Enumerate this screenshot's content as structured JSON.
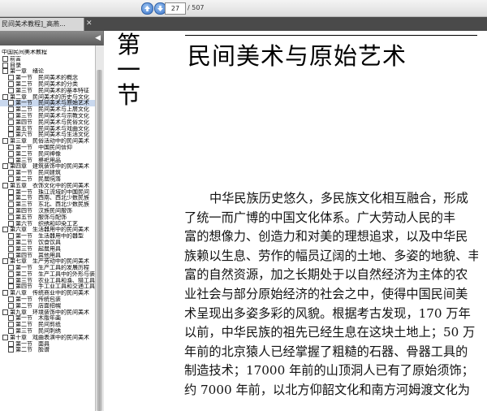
{
  "toolbar": {
    "prev_icon": "up-arrow-icon",
    "next_icon": "down-arrow-icon",
    "page_current": "27",
    "page_total": "/ 507"
  },
  "tab": {
    "title": "民间美术教程]_高燕...",
    "close_icon": "close-icon"
  },
  "sidebar": {
    "collapse_icon": "triangle-left-icon",
    "items": [
      {
        "label": "中国民间美术教程",
        "level": 0
      },
      {
        "label": "前言",
        "level": 1
      },
      {
        "label": "目录",
        "level": 1
      },
      {
        "label": "第一章　绪论",
        "level": 1
      },
      {
        "label": "第一节　民间美术的概念",
        "level": 2
      },
      {
        "label": "第二节　民间美术的分类",
        "level": 2
      },
      {
        "label": "第三节　民间美术的基本特征",
        "level": 2
      },
      {
        "label": "第二章　民间美术的历史与文化",
        "level": 1
      },
      {
        "label": "第一节　民间美术与原始艺术",
        "level": 2,
        "selected": true
      },
      {
        "label": "第二节　民间美术与上层文化",
        "level": 2
      },
      {
        "label": "第三节　民间美术与宗教文化",
        "level": 2
      },
      {
        "label": "第四节　民间美术与民俗文化",
        "level": 2
      },
      {
        "label": "第五节　民间美术与戏曲文化",
        "level": 2
      },
      {
        "label": "第六节　民间美术与生活文化",
        "level": 2
      },
      {
        "label": "第三章　民俗活动中的民间美术",
        "level": 1
      },
      {
        "label": "第一节　中国民间信仰",
        "level": 2
      },
      {
        "label": "第二节　民间神像",
        "level": 2
      },
      {
        "label": "第三节　祭祀用品",
        "level": 2
      },
      {
        "label": "第四章　建筑装饰中的民间美术",
        "level": 1
      },
      {
        "label": "第一节　民间建筑",
        "level": 2
      },
      {
        "label": "第二节　民居院落",
        "level": 2
      },
      {
        "label": "第五章　衣饰文化中的民间美术",
        "level": 1
      },
      {
        "label": "第一节　珠江流域的中国民间",
        "level": 2
      },
      {
        "label": "第二节　西南、西北少数民族",
        "level": 2
      },
      {
        "label": "第三节　东北、西北少数民族",
        "level": 2
      },
      {
        "label": "第四节　汉族民间服饰",
        "level": 2
      },
      {
        "label": "第五节　服饰与配饰",
        "level": 2
      },
      {
        "label": "第六节　织绣和印染工艺",
        "level": 2
      },
      {
        "label": "第六章　生活器用中的民间美术",
        "level": 1
      },
      {
        "label": "第一节　生活器用中的器型",
        "level": 2
      },
      {
        "label": "第二节　饮食饮具",
        "level": 2
      },
      {
        "label": "第三节　起居用具",
        "level": 2
      },
      {
        "label": "第四节　其他用具",
        "level": 2
      },
      {
        "label": "第七章　生产劳动中的民间美术",
        "level": 1
      },
      {
        "label": "第一节　生产工具的发展历程",
        "level": 2
      },
      {
        "label": "第二节　生产工具中的外形与装饰",
        "level": 2
      },
      {
        "label": "第三节　农业工具和渔、猎工具",
        "level": 2
      },
      {
        "label": "第四节　手工业工具和交通工具",
        "level": 2
      },
      {
        "label": "第八章　传统商业中的民间美术",
        "level": 1
      },
      {
        "label": "第一节　传统包装",
        "level": 2
      },
      {
        "label": "第二节　店面招幌",
        "level": 2
      },
      {
        "label": "第九章　环境装饰中的民间美术",
        "level": 1
      },
      {
        "label": "第一节　木版年画",
        "level": 2
      },
      {
        "label": "第二节　民间剪纸",
        "level": 2
      },
      {
        "label": "第三节　民间刺绣",
        "level": 2
      },
      {
        "label": "第十章　戏曲表演中的民间美术",
        "level": 1
      },
      {
        "label": "第一节　面具",
        "level": 2
      },
      {
        "label": "第二节　脸谱",
        "level": 2
      }
    ]
  },
  "page": {
    "chapter_heading": "第一节",
    "section_title": "民间美术与原始艺术",
    "body_lines": [
      "中华民族历史悠久，多民族文化相互融合，形成",
      "了统一而广博的中国文化体系。广大劳动人民的丰",
      "富的想像力、创造力和对美的理想追求，以及中华民",
      "族赖以生息、劳作的幅员辽阔的土地、多姿的地貌、丰",
      "富的自然资源，加之长期处于以自然经济为主体的农",
      "业社会与部分原始经济的社会之中，使得中国民间美",
      "术呈现出多姿多彩的风貌。根据考古发现，170 万年",
      "以前，中华民族的祖先已经生息在这块土地上；50 万",
      "年前的北京猿人已经掌握了粗糙的石器、骨器工具的",
      "制造技术；17000 年前的山顶洞人已有了原始须饰；",
      "约 7000 年前，以北方仰韶文化和南方河姆渡文化为"
    ]
  }
}
